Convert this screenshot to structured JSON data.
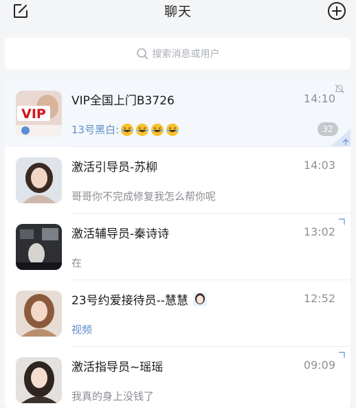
{
  "header": {
    "title": "聊天",
    "edit_icon": "edit-icon",
    "add_icon": "add-circle-icon"
  },
  "search": {
    "placeholder": "搜索消息或用户",
    "icon": "search-icon"
  },
  "chats": [
    {
      "name": "VIP全国上门B3726",
      "time": "14:10",
      "preview_sender": "13号黑白:",
      "preview_emoji_count": 4,
      "unread": "32",
      "muted": true,
      "pinned": true
    },
    {
      "name": "激活引导员-苏柳",
      "time": "14:03",
      "preview": "哥哥你不完成修复我怎么帮你呢"
    },
    {
      "name": "激活辅导员-秦诗诗",
      "time": "13:02",
      "preview": "在"
    },
    {
      "name": "23号约爱接待员--慧慧",
      "time": "12:52",
      "preview": "视频"
    },
    {
      "name": "激活指导员~瑶瑶",
      "time": "09:09",
      "preview": "我真的身上没钱了"
    }
  ],
  "colors": {
    "accent_blue": "#5d8fc9",
    "badge_gray": "#c4c7cc",
    "background": "#f4f5f7"
  }
}
